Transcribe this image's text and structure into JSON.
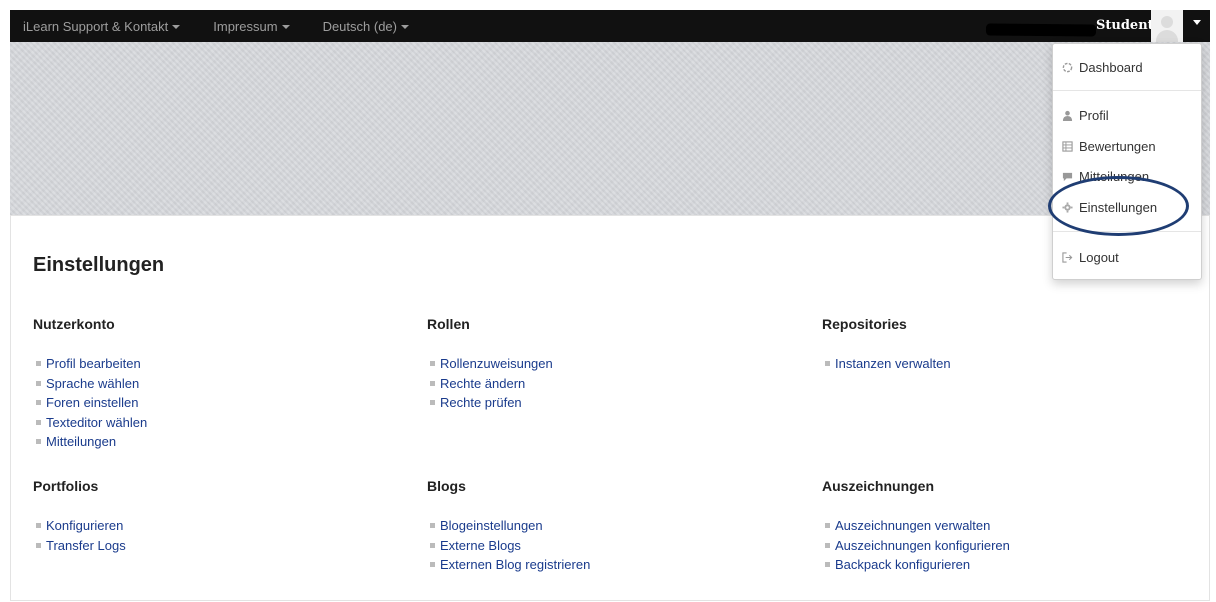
{
  "navbar": {
    "items": [
      {
        "label": "iLearn Support & Kontakt"
      },
      {
        "label": "Impressum"
      },
      {
        "label": "Deutsch (de)"
      }
    ],
    "user_name": "Student"
  },
  "user_menu": {
    "items": [
      {
        "label": "Dashboard",
        "icon": "dashboard-icon"
      },
      {
        "label": "Profil",
        "icon": "user-icon"
      },
      {
        "label": "Bewertungen",
        "icon": "grades-table-icon"
      },
      {
        "label": "Mitteilungen",
        "icon": "message-icon"
      },
      {
        "label": "Einstellungen",
        "icon": "gear-icon"
      },
      {
        "label": "Logout",
        "icon": "logout-icon"
      }
    ]
  },
  "page": {
    "title": "Einstellungen"
  },
  "sections": {
    "nutzerkonto": {
      "title": "Nutzerkonto",
      "links": [
        "Profil bearbeiten",
        "Sprache wählen",
        "Foren einstellen",
        "Texteditor wählen",
        "Mitteilungen"
      ]
    },
    "rollen": {
      "title": "Rollen",
      "links": [
        "Rollenzuweisungen",
        "Rechte ändern",
        "Rechte prüfen"
      ]
    },
    "repositories": {
      "title": "Repositories",
      "links": [
        "Instanzen verwalten"
      ]
    },
    "portfolios": {
      "title": "Portfolios",
      "links": [
        "Konfigurieren",
        "Transfer Logs"
      ]
    },
    "blogs": {
      "title": "Blogs",
      "links": [
        "Blogeinstellungen",
        "Externe Blogs",
        "Externen Blog registrieren"
      ]
    },
    "auszeichnungen": {
      "title": "Auszeichnungen",
      "links": [
        "Auszeichnungen verwalten",
        "Auszeichnungen konfigurieren",
        "Backpack konfigurieren"
      ]
    }
  },
  "colors": {
    "navbar_bg": "#111111",
    "link": "#1a3b8c",
    "highlight_ring": "#1f3d73"
  }
}
